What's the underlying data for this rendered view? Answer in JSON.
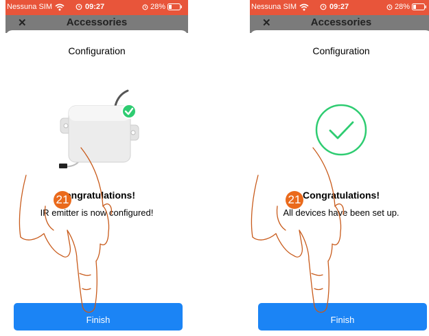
{
  "status_bar": {
    "carrier": "Nessuna SIM",
    "time": "09:27",
    "battery": "28%"
  },
  "screens": [
    {
      "background_title": "Accessories",
      "sheet_title": "Configuration",
      "heading": "Congratulations!",
      "message": "IR emitter is now configured!",
      "finish_label": "Finish",
      "step_badge": "21"
    },
    {
      "background_title": "Accessories",
      "sheet_title": "Configuration",
      "heading": "Congratulations!",
      "message": "All devices have been set up.",
      "finish_label": "Finish",
      "step_badge": "21"
    }
  ],
  "colors": {
    "status_bar": "#e8553a",
    "finish_button": "#1b84f5",
    "success": "#2ecc71",
    "badge": "#ea6a1c"
  },
  "icons": [
    "wifi-icon",
    "alarm-icon",
    "battery-icon",
    "close-icon",
    "checkmark-icon",
    "ir-emitter-device",
    "hand-pointer"
  ]
}
